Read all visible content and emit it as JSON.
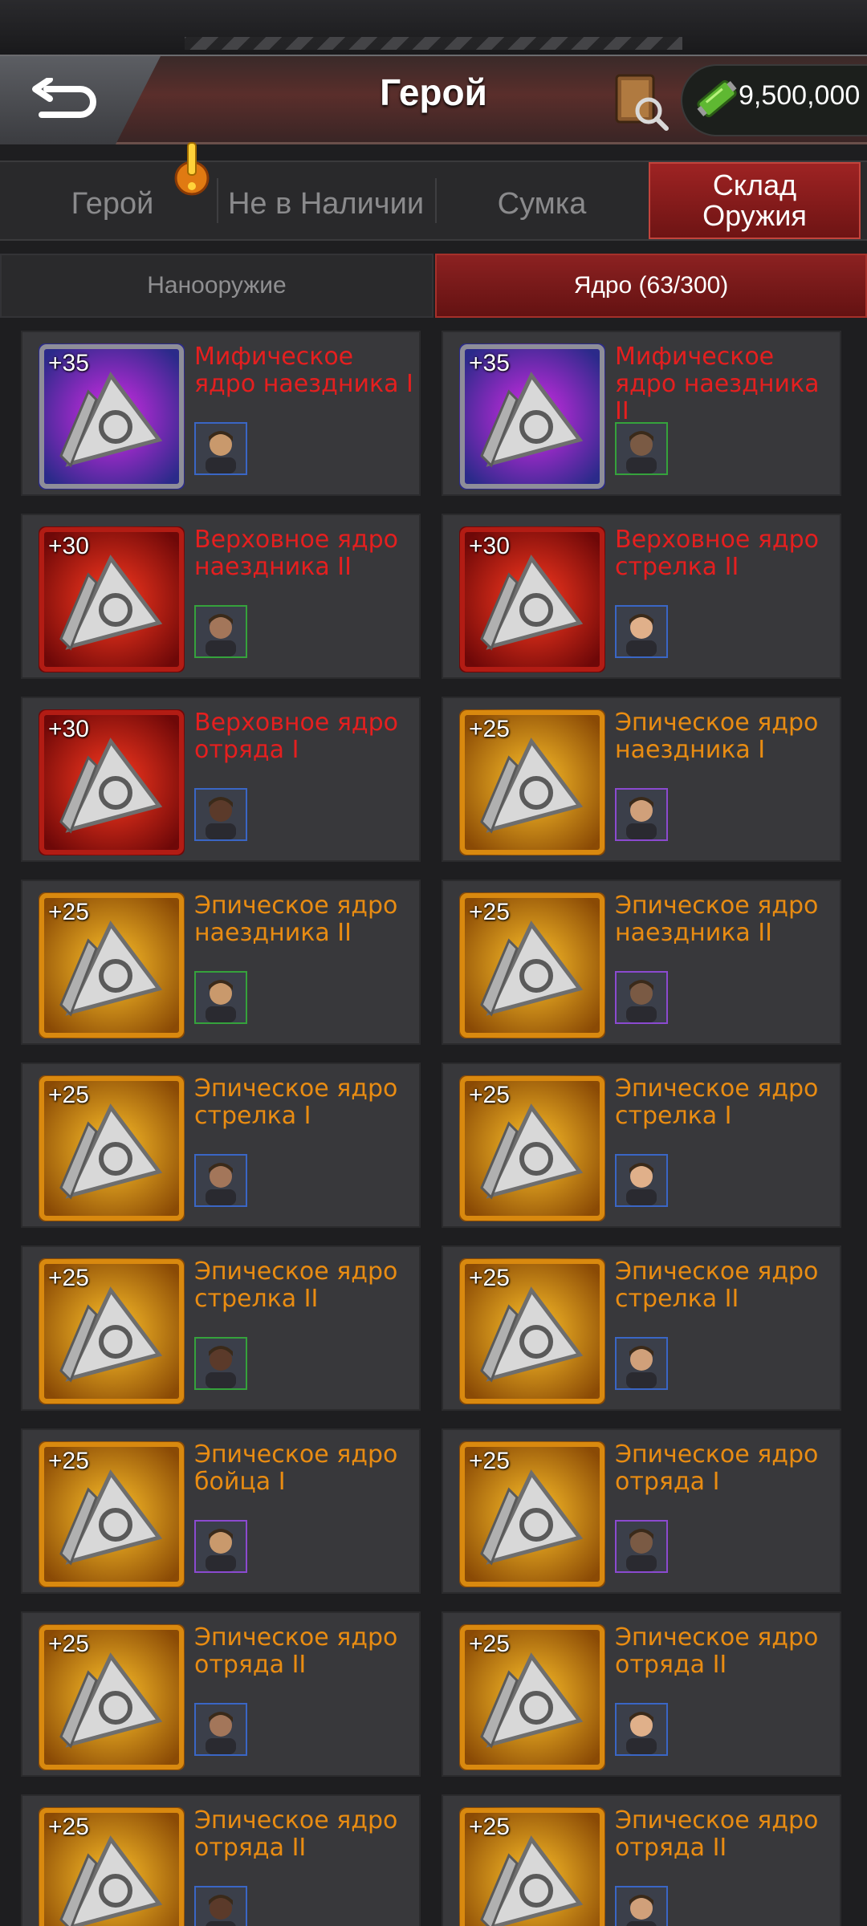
{
  "header": {
    "title": "Герой",
    "currency_value": "9,500,000"
  },
  "tabs": [
    {
      "label": "Герой",
      "active": false
    },
    {
      "label": "Не в Наличии",
      "active": false
    },
    {
      "label": "Сумка",
      "active": false
    },
    {
      "label_line1": "Склад",
      "label_line2": "Оружия",
      "active": true
    }
  ],
  "subtabs": [
    {
      "label": "Нанооружие",
      "active": false
    },
    {
      "label": "Ядро (63/300)",
      "active": true
    }
  ],
  "items": [
    {
      "level": "+35",
      "name": "Мифическое ядро наездника I",
      "rarity": "mythic",
      "avatar": "nurse-avatar"
    },
    {
      "level": "+35",
      "name": "Мифическое ядро наездника II",
      "rarity": "mythic",
      "avatar": "soldier-avatar"
    },
    {
      "level": "+30",
      "name": "Верховное ядро наездника II",
      "rarity": "supreme",
      "avatar": "sunglasses-avatar"
    },
    {
      "level": "+30",
      "name": "Верховное ядро стрелка II",
      "rarity": "supreme",
      "avatar": "twins-avatar"
    },
    {
      "level": "+30",
      "name": "Верховное ядро отряда I",
      "rarity": "supreme",
      "avatar": "cowboy-avatar"
    },
    {
      "level": "+25",
      "name": "Эпическое ядро наездника I",
      "rarity": "epic",
      "avatar": "fighter-avatar"
    },
    {
      "level": "+25",
      "name": "Эпическое ядро наездника II",
      "rarity": "epic",
      "avatar": "masked-avatar"
    },
    {
      "level": "+25",
      "name": "Эпическое ядро наездника II",
      "rarity": "epic",
      "avatar": "gasmask-avatar"
    },
    {
      "level": "+25",
      "name": "Эпическое ядро стрелка I",
      "rarity": "epic",
      "avatar": "redhead-avatar"
    },
    {
      "level": "+25",
      "name": "Эпическое ядро стрелка I",
      "rarity": "epic",
      "avatar": "woman-avatar"
    },
    {
      "level": "+25",
      "name": "Эпическое ядро стрелка II",
      "rarity": "epic",
      "avatar": "brunette-avatar"
    },
    {
      "level": "+25",
      "name": "Эпическое ядро стрелка II",
      "rarity": "epic",
      "avatar": "man-avatar"
    },
    {
      "level": "+25",
      "name": "Эпическое ядро бойца I",
      "rarity": "epic",
      "avatar": "ninja-avatar"
    },
    {
      "level": "+25",
      "name": "Эпическое ядро отряда I",
      "rarity": "epic",
      "avatar": "blonde-avatar"
    },
    {
      "level": "+25",
      "name": "Эпическое ядро отряда II",
      "rarity": "epic",
      "avatar": "hat-avatar"
    },
    {
      "level": "+25",
      "name": "Эпическое ядро отряда II",
      "rarity": "epic",
      "avatar": "blonde2-avatar"
    },
    {
      "level": "+25",
      "name": "Эпическое ядро отряда II",
      "rarity": "epic",
      "avatar": "agent-avatar"
    },
    {
      "level": "+25",
      "name": "Эпическое ядро отряда II",
      "rarity": "epic",
      "avatar": "bald-avatar"
    }
  ],
  "colors": {
    "mythic_text": "#e51f1f",
    "supreme_text": "#e51f1f",
    "epic_text": "#e98c12",
    "active_tab": "#9e2323"
  }
}
